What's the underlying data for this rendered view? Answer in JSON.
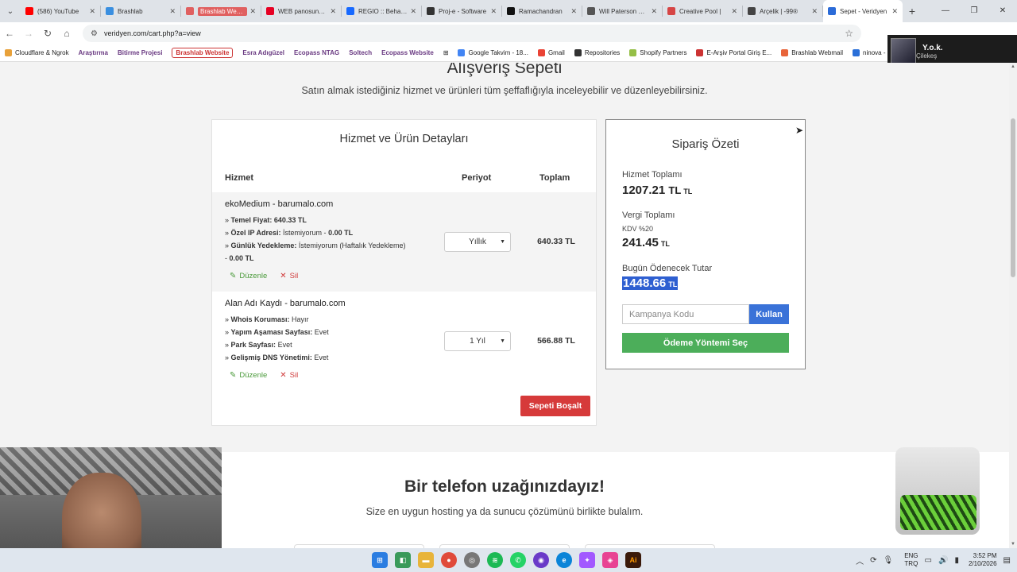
{
  "browser": {
    "tabs": [
      {
        "title": "(586) YouTube",
        "color": "#ff0000"
      },
      {
        "title": "Brashlab",
        "color": "#3a8fe0"
      },
      {
        "title": "Brashlab Website",
        "color": "#e06060",
        "highlight": true
      },
      {
        "title": "WEB panosundaki",
        "color": "#e60023"
      },
      {
        "title": "REGIO :: Behance",
        "color": "#1769ff"
      },
      {
        "title": "Proj-e - Software",
        "color": "#333333"
      },
      {
        "title": "Ramachandran",
        "color": "#111111"
      },
      {
        "title": "Will Paterson Desi",
        "color": "#555555"
      },
      {
        "title": "Creative Pool |",
        "color": "#d64545"
      },
      {
        "title": "Arçelik | -99®",
        "color": "#444444"
      },
      {
        "title": "Sepet - Veridyen",
        "color": "#2b6bd8",
        "active": true
      }
    ],
    "url": "veridyen.com/cart.php?a=view",
    "bookmarks": [
      "Cloudflare & Ngrok",
      "Araştırma",
      "Bitirme Projesi",
      "Brashlab Website",
      "Esra Adıgüzel",
      "Ecopass NTAG",
      "Soltech",
      "Ecopass Website",
      "Google Takvim - 18...",
      "Gmail",
      "Repositories",
      "Shopify Partners",
      "E-Arşiv Portal Giriş E...",
      "Brashlab Webmail",
      "ninova - İTÜ e..."
    ],
    "profile": {
      "name": "Y.o.k.",
      "sub": "Çilekeş"
    }
  },
  "page": {
    "title": "Alışveriş Sepeti",
    "subtitle": "Satın almak istediğiniz hizmet ve ürünleri tüm şeffaflığıyla inceleyebilir ve düzenleyebilirsiniz."
  },
  "cart": {
    "heading": "Hizmet ve Ürün Detayları",
    "col_service": "Hizmet",
    "col_period": "Periyot",
    "col_total": "Toplam",
    "items": [
      {
        "name": "ekoMedium - barumalo.com",
        "lines": [
          {
            "prefix": "» ",
            "label": "Temel Fiyat:",
            "value": " 640.33 TL",
            "value_bold": true
          },
          {
            "prefix": "» ",
            "label": "Özel IP Adresi:",
            "value": " İstemiyorum - ",
            "extra": "0.00 TL"
          },
          {
            "prefix": "» ",
            "label": "Günlük Yedekleme:",
            "value": " İstemiyorum (Haftalık Yedekleme) - ",
            "extra": "0.00 TL"
          }
        ],
        "period": "Yıllık",
        "total": "640.33 TL",
        "edit": "Düzenle",
        "delete": "Sil"
      },
      {
        "name": "Alan Adı Kaydı - barumalo.com",
        "lines": [
          {
            "prefix": "» ",
            "label": "Whois Koruması:",
            "value": " Hayır"
          },
          {
            "prefix": "» ",
            "label": "Yapım Aşaması Sayfası:",
            "value": " Evet"
          },
          {
            "prefix": "» ",
            "label": "Park Sayfası:",
            "value": " Evet"
          },
          {
            "prefix": "» ",
            "label": "Gelişmiş DNS Yönetimi:",
            "value": " Evet"
          }
        ],
        "period": "1 Yıl",
        "total": "566.88 TL",
        "edit": "Düzenle",
        "delete": "Sil"
      }
    ],
    "empty_button": "Sepeti Boşalt"
  },
  "summary": {
    "title": "Sipariş Özeti",
    "service_total_label": "Hizmet Toplamı",
    "service_total": "1207.21 TL",
    "service_total_num": "1207.21",
    "tax_label": "Vergi Toplamı",
    "tax_sub": "KDV %20",
    "tax_num": "241.45",
    "due_label": "Bugün Ödenecek Tutar",
    "due_num": "1448.66",
    "currency": "TL",
    "promo_placeholder": "Kampanya Kodu",
    "apply_button": "Kullan",
    "pay_button": "Ödeme Yöntemi Seç"
  },
  "contact": {
    "title": "Bir telefon uzağınızdayız!",
    "subtitle": "Size en uygun hosting ya da sunucu çözümünü birlikte bulalım."
  },
  "taskbar": {
    "lang_top": "ENG",
    "lang_bottom": "TRQ",
    "time": "3:52 PM",
    "date": "2/10/2026"
  },
  "colors": {
    "danger": "#d63a3a",
    "primary": "#3a72d8",
    "success": "#4cae5a",
    "selection": "#2e5fd1"
  }
}
